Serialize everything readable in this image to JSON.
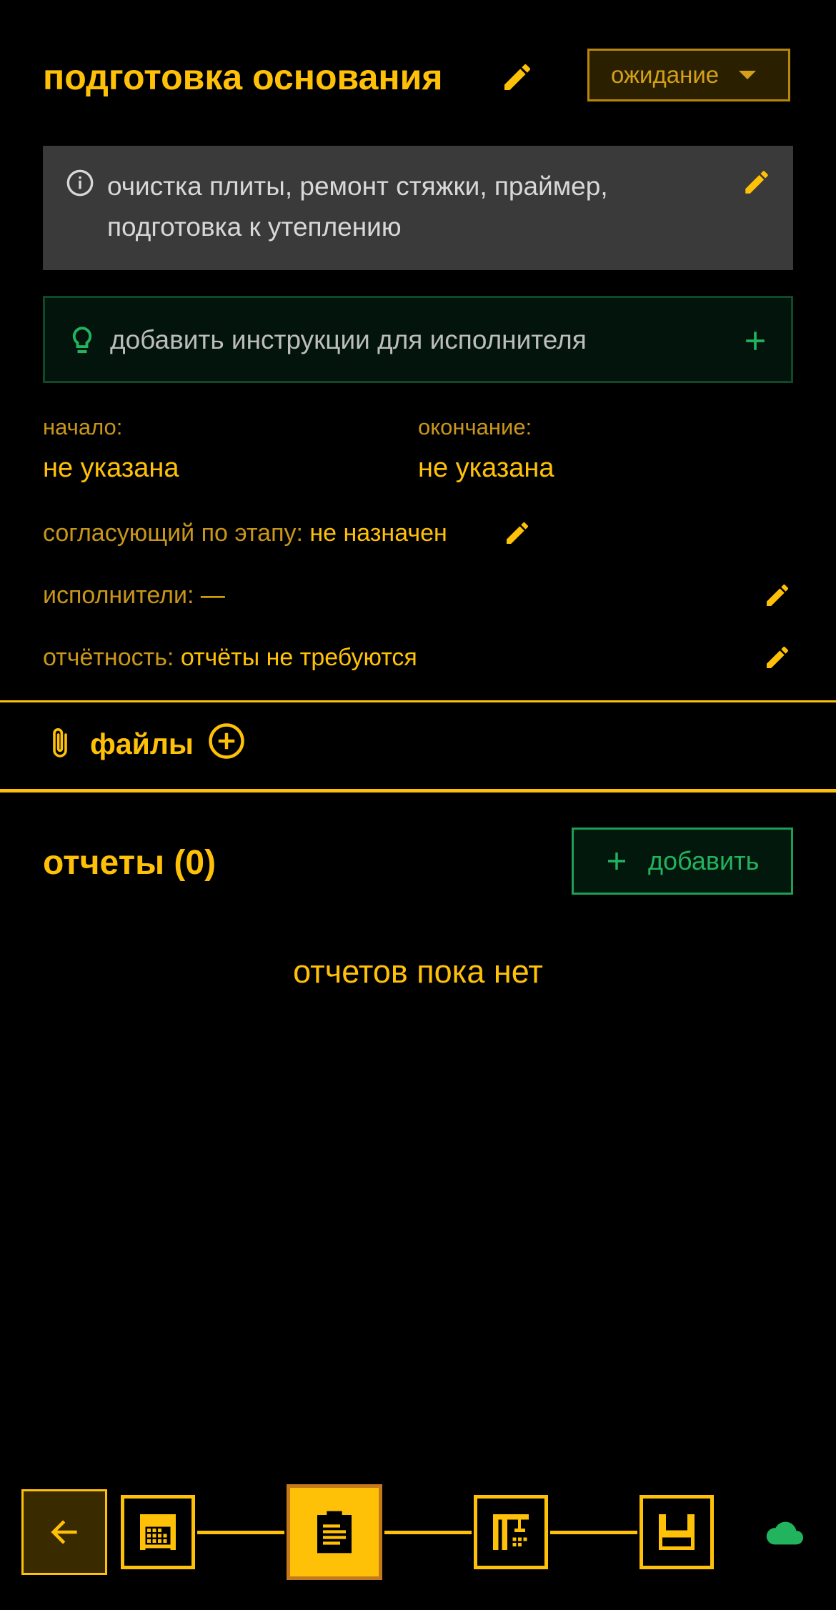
{
  "header": {
    "title": "подготовка основания",
    "status": "ожидание",
    "icons": {
      "edit": "pencil-icon",
      "caret": "caret-down-icon"
    }
  },
  "description": {
    "text": "очистка плиты, ремонт стяжки, праймер, подготовка к утеплению",
    "icons": {
      "info": "info-icon",
      "edit": "pencil-icon"
    }
  },
  "instructions": {
    "placeholder": "добавить инструкции для исполнителя",
    "icons": {
      "bulb": "lightbulb-icon",
      "add": "plus-icon"
    }
  },
  "dates": {
    "start_label": "начало:",
    "start_value": "не указана",
    "end_label": "окончание:",
    "end_value": "не указана"
  },
  "approver": {
    "label": "согласующий по этапу:",
    "value": "не назначен"
  },
  "executors": {
    "label": "исполнители:",
    "value": "—"
  },
  "reporting": {
    "label": "отчётность:",
    "value": "отчёты не требуются"
  },
  "files": {
    "label": "файлы",
    "icons": {
      "clip": "paperclip-icon",
      "add": "add-circle-icon"
    }
  },
  "reports": {
    "title": "отчеты (0)",
    "add_label": "добавить",
    "empty_text": "отчетов пока нет"
  },
  "bottom_nav": {
    "back_icon": "arrow-left-icon",
    "steps": [
      "building-icon",
      "clipboard-icon",
      "crane-icon",
      "floppy-icon"
    ],
    "active_step": 1,
    "right_icon": "cloud-icon"
  },
  "colors": {
    "accent": "#FFC107",
    "accent_dim": "#C9961A",
    "green": "#22B35E",
    "background": "#000000",
    "card": "#3A3A3A"
  }
}
